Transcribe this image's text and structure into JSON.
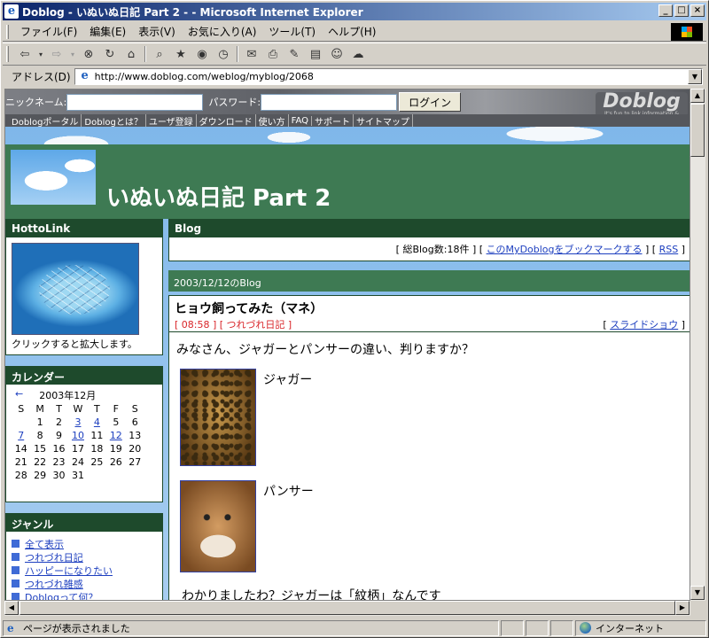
{
  "window": {
    "title": "Doblog - いぬいぬ日記 Part 2 - - Microsoft Internet Explorer"
  },
  "menu": [
    "ファイル(F)",
    "編集(E)",
    "表示(V)",
    "お気に入り(A)",
    "ツール(T)",
    "ヘルプ(H)"
  ],
  "address": {
    "label": "アドレス(D)",
    "url": "http://www.doblog.com/weblog/myblog/2068"
  },
  "login": {
    "nickname_label": "ニックネーム:",
    "password_label": "パスワード:",
    "button": "ログイン"
  },
  "logo": {
    "text": "Doblog",
    "tagline": "It's fun to link information & people!"
  },
  "nav": [
    "Doblogポータル",
    "Doblogとは？",
    "ユーザ登録",
    "ダウンロード",
    "使い方",
    "FAQ",
    "サポート",
    "サイトマップ"
  ],
  "blog": {
    "title": "いぬいぬ日記 Part 2"
  },
  "hottolink": {
    "heading": "HottoLink",
    "caption": "クリックすると拡大します。"
  },
  "calendar": {
    "heading": "カレンダー",
    "prev": "←",
    "month": "2003年12月",
    "days": [
      "S",
      "M",
      "T",
      "W",
      "T",
      "F",
      "S"
    ],
    "weeks": [
      [
        "",
        "1",
        "2",
        "3",
        "4",
        "5",
        "6"
      ],
      [
        "7",
        "8",
        "9",
        "10",
        "11",
        "12",
        "13"
      ],
      [
        "14",
        "15",
        "16",
        "17",
        "18",
        "19",
        "20"
      ],
      [
        "21",
        "22",
        "23",
        "24",
        "25",
        "26",
        "27"
      ],
      [
        "28",
        "29",
        "30",
        "31",
        "",
        "",
        ""
      ]
    ],
    "linked_days": [
      "3",
      "4",
      "7",
      "10",
      "12"
    ]
  },
  "genre": {
    "heading": "ジャンル",
    "items": [
      "全て表示",
      "つれづれ日記",
      "ハッピーになりたい",
      "つれづれ雑感",
      "Doblogって何？"
    ]
  },
  "main": {
    "heading": "Blog",
    "count_prefix": "[ 総Blog数:18件 ] [ ",
    "bookmark_link": "このMyDoblogをブックマークする",
    "mid": " ] [ ",
    "rss": "RSS",
    "suffix": " ]",
    "day_title": "2003/12/12のBlog"
  },
  "post": {
    "title": "ヒョウ飼ってみた（マネ）",
    "tag": "[ 08:58 ] [ つれづれ日記 ]",
    "slide_open": "[ ",
    "slide_link": "スライドショウ",
    "slide_close": " ]",
    "intro": "みなさん、ジャガーとパンサーの違い、判りますか？",
    "jaguar_label": "ジャガー",
    "panther_label": "パンサー",
    "outro": "わかりましたわ？ジャガーは「紋柄」なんです"
  },
  "status": {
    "text": "ページが表示されました",
    "zone": "インターネット"
  },
  "colors": {
    "title_gradient_start": "#0a246a",
    "header_green": "#3e7a53",
    "box_green": "#1e4a2c",
    "link_blue": "#1d3fbf",
    "tag_red": "#d9262a"
  }
}
